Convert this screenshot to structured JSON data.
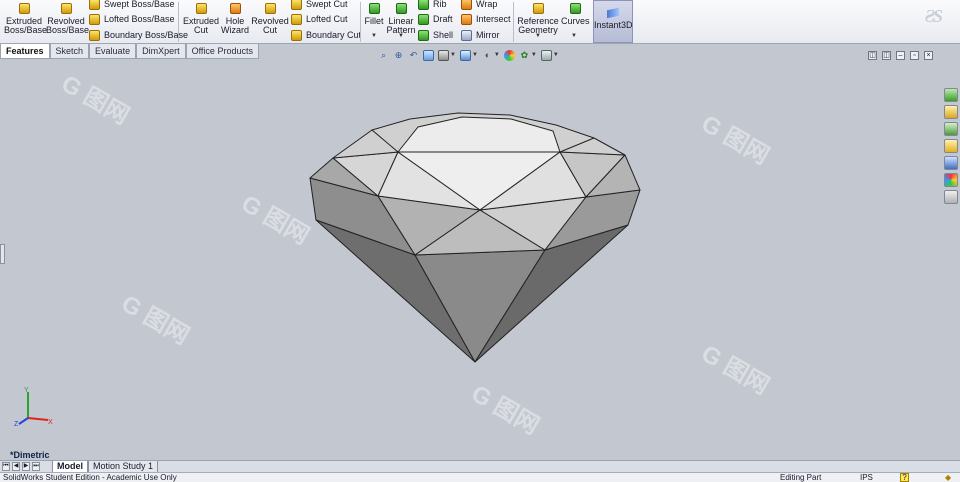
{
  "ribbon": {
    "extruded_boss": "Extruded Boss/Base",
    "revolved_boss": "Revolved Boss/Base",
    "swept_boss": "Swept Boss/Base",
    "lofted_boss": "Lofted Boss/Base",
    "boundary_boss": "Boundary Boss/Base",
    "extruded_cut": "Extruded Cut",
    "hole_wizard": "Hole Wizard",
    "revolved_cut": "Revolved Cut",
    "swept_cut": "Swept Cut",
    "lofted_cut": "Lofted Cut",
    "boundary_cut": "Boundary Cut",
    "fillet": "Fillet",
    "linear_pattern": "Linear Pattern",
    "rib": "Rib",
    "draft": "Draft",
    "shell": "Shell",
    "wrap": "Wrap",
    "intersect": "Intersect",
    "mirror": "Mirror",
    "reference_geometry": "Reference Geometry",
    "curves": "Curves",
    "instant3d": "Instant3D"
  },
  "tabs": [
    "Features",
    "Sketch",
    "Evaluate",
    "DimXpert",
    "Office Products"
  ],
  "active_tab": "Features",
  "view": {
    "orientation": "*Dimetric",
    "triad": {
      "x": "X",
      "y": "Y",
      "z": "Z"
    },
    "background_color": "#c3c8d0",
    "part_color": "#a8a8a8"
  },
  "bottom_tabs": [
    "Model",
    "Motion Study 1"
  ],
  "status": {
    "left": "SolidWorks Student Edition - Academic Use Only",
    "mode": "Editing Part",
    "units": "IPS",
    "help": "?"
  },
  "icons": {
    "view_toolbar": [
      "zoom-to-fit-icon",
      "zoom-to-area-icon",
      "previous-view-icon",
      "section-view-icon",
      "view-orientation-icon",
      "display-style-icon",
      "hide-show-items-icon",
      "edit-appearance-icon",
      "apply-scene-icon",
      "view-settings-icon"
    ],
    "task_pane": [
      "solidworks-resources-icon",
      "design-library-icon",
      "file-explorer-icon",
      "view-palette-icon",
      "appearances-icon",
      "custom-properties-icon"
    ]
  }
}
